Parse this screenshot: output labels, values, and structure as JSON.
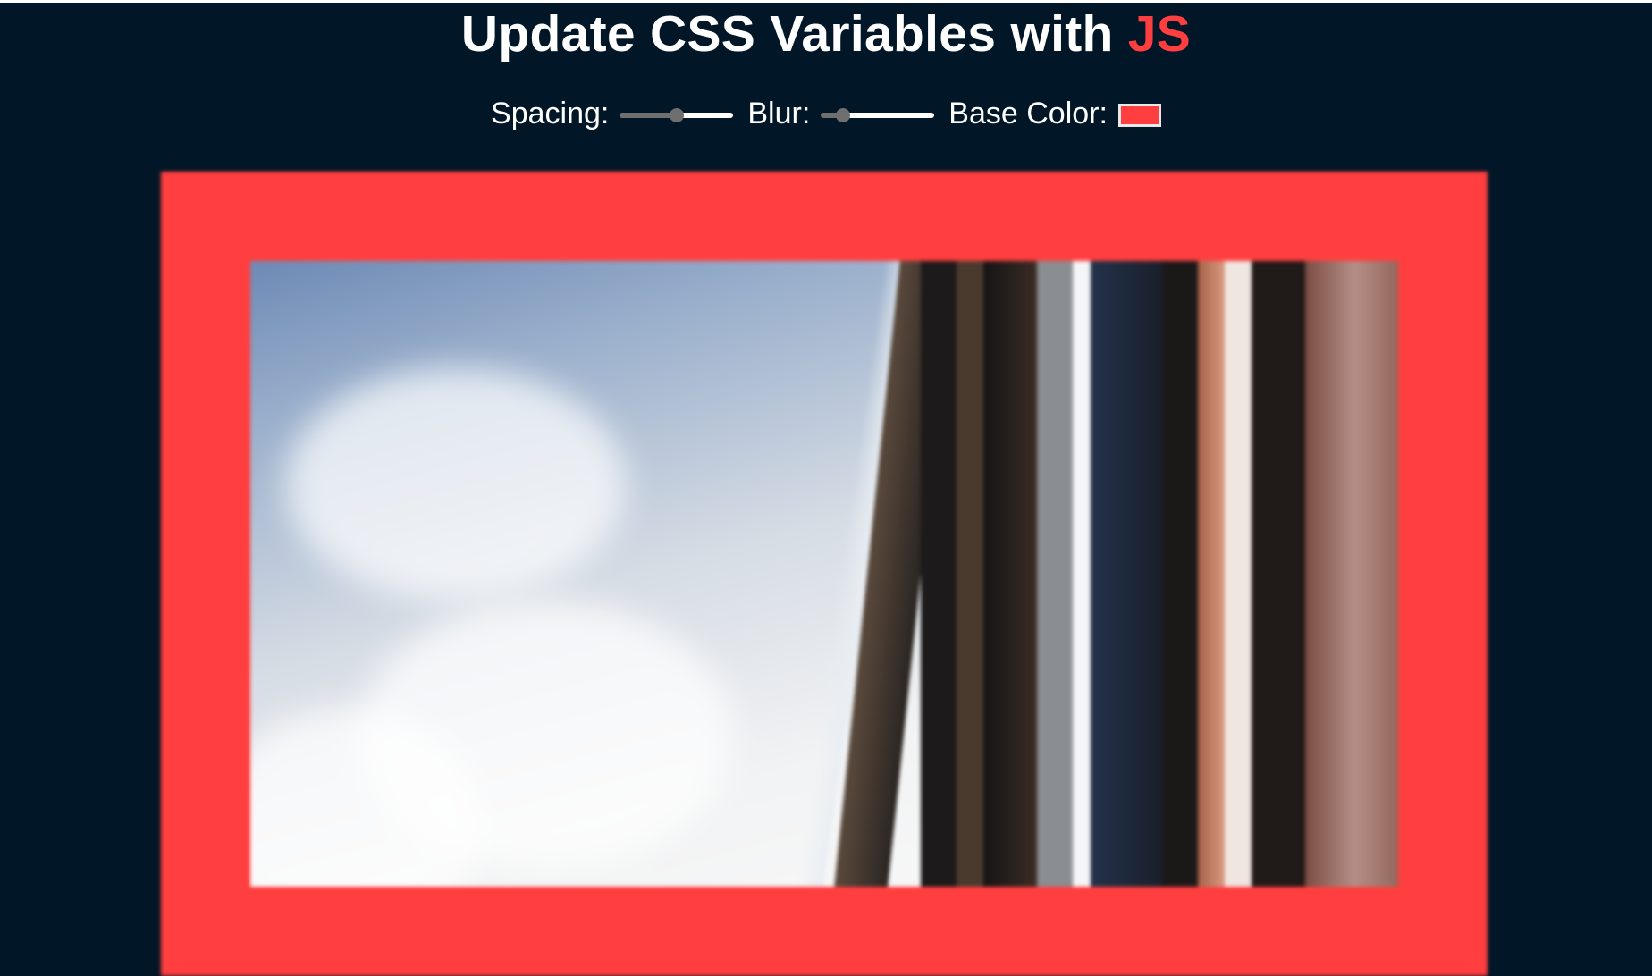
{
  "page": {
    "title_main": "Update CSS Variables with ",
    "title_highlight": "JS"
  },
  "controls": {
    "spacing": {
      "label": "Spacing:",
      "value_fraction": 0.5
    },
    "blur": {
      "label": "Blur:",
      "value_fraction": 0.2
    },
    "base_color": {
      "label": "Base Color:",
      "value": "#ff3f3f"
    }
  },
  "colors": {
    "background": "#011627",
    "accent": "#ff3f3f"
  },
  "image": {
    "description_icon": "photo-image"
  }
}
